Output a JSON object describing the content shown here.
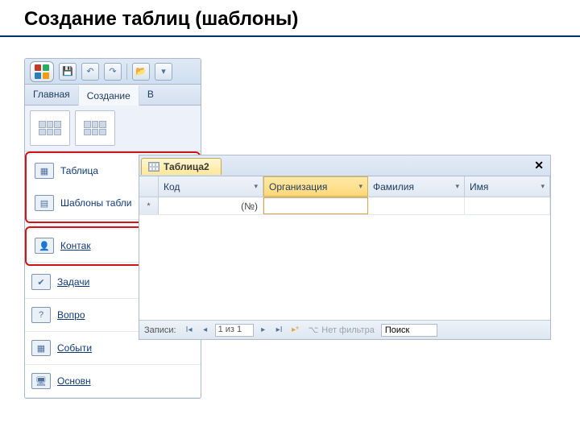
{
  "slide": {
    "title": "Создание таблиц (шаблоны)"
  },
  "ribbon": {
    "tabs": {
      "home": "Главная",
      "create": "Создание",
      "other": "В"
    },
    "menu": {
      "table": "Таблица",
      "templates": "Шаблоны табли",
      "contacts": "Контак",
      "tasks": "Задачи",
      "questions": "Вопро",
      "events": "Событи",
      "assets": "Основн"
    }
  },
  "datasheet": {
    "tab_label": "Таблица2",
    "columns": {
      "id": "Код",
      "org": "Организация",
      "lastname": "Фамилия",
      "firstname": "Имя"
    },
    "newrow_id": "(№)",
    "nav": {
      "label": "Записи:",
      "pos": "1 из 1",
      "filter": "Нет фильтра",
      "search": "Поиск"
    }
  }
}
